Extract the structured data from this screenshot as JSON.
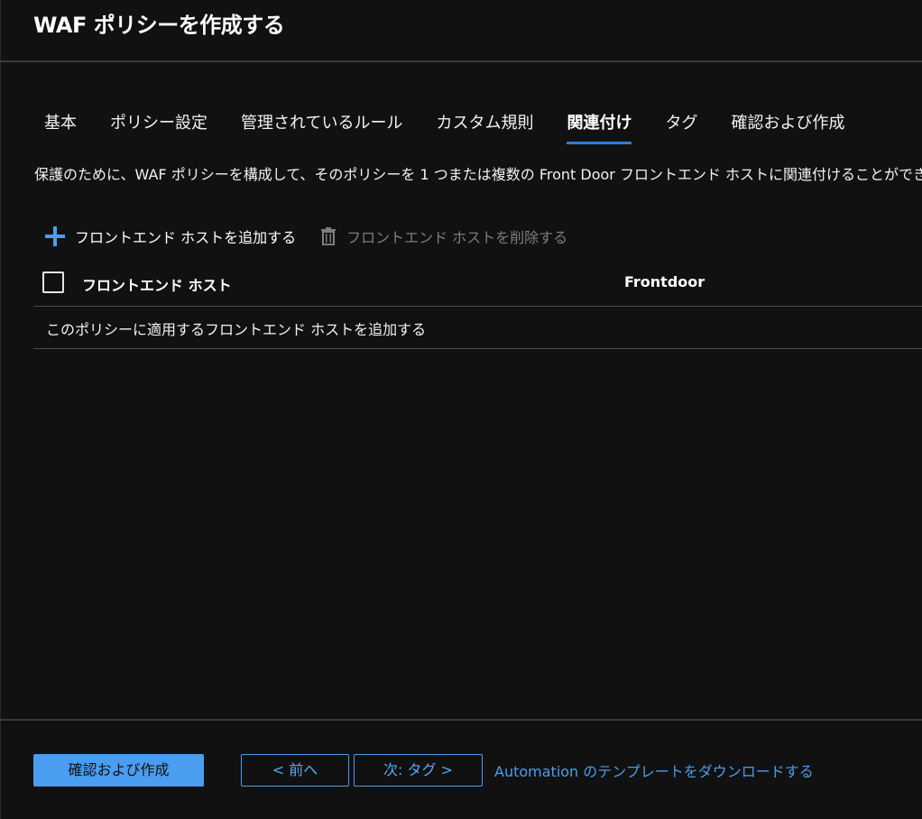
{
  "header": {
    "title": "WAF ポリシーを作成する"
  },
  "tabs": [
    {
      "label": "基本"
    },
    {
      "label": "ポリシー設定"
    },
    {
      "label": "管理されているルール"
    },
    {
      "label": "カスタム規則"
    },
    {
      "label": "関連付け",
      "active": true
    },
    {
      "label": "タグ"
    },
    {
      "label": "確認および作成"
    }
  ],
  "description": "保護のために、WAF ポリシーを構成して、そのポリシーを 1 つまたは複数の Front Door フロントエンド ホストに関連付けることができ",
  "toolbar": {
    "add_label": "フロントエンド ホストを追加する",
    "add_icon": "plus-icon",
    "delete_label": "フロントエンド ホストを削除する",
    "delete_icon": "trash-icon"
  },
  "table": {
    "columns": [
      "フロントエンド ホスト",
      "Frontdoor"
    ],
    "empty_message": "このポリシーに適用するフロントエンド ホストを追加する"
  },
  "footer": {
    "review_create_label": "確認および作成",
    "prev_label": "< 前へ",
    "next_label": "次: タグ >",
    "automation_link": "Automation のテンプレートをダウンロードする"
  },
  "colors": {
    "background": "#111111",
    "accent": "#4a9df0",
    "tab_underline": "#2f7fd6",
    "disabled_text": "#7d7d7d"
  }
}
